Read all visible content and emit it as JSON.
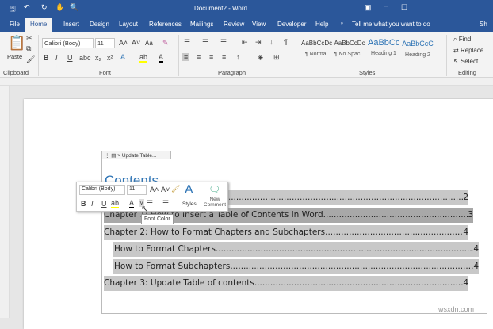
{
  "title": "Document2 - Word",
  "tabs": [
    "File",
    "Home",
    "Insert",
    "Design",
    "Layout",
    "References",
    "Mailings",
    "Review",
    "View",
    "Developer",
    "Help"
  ],
  "tell_me": "Tell me what you want to do",
  "share": "Sh",
  "clipboard": {
    "paste": "Paste",
    "label": "Clipboard"
  },
  "font": {
    "name": "Calibri (Body)",
    "size": "11",
    "label": "Font",
    "change_case": "Aa"
  },
  "paragraph": {
    "label": "Paragraph"
  },
  "styles": {
    "label": "Styles",
    "items": [
      {
        "preview": "AaBbCcDc",
        "name": "¶ Normal"
      },
      {
        "preview": "AaBbCcDc",
        "name": "¶ No Spac..."
      },
      {
        "preview": "AaBbCc",
        "name": "Heading 1"
      },
      {
        "preview": "AaBbCcC",
        "name": "Heading 2"
      }
    ]
  },
  "editing": {
    "label": "Editing",
    "find": "Find",
    "replace": "Replace",
    "select": "Select"
  },
  "toc": {
    "update_button": "Update Table...",
    "heading": "Contents",
    "entries": [
      {
        "text": "",
        "page": "2"
      },
      {
        "text": "Chapter 1: How to Insert a Table of Contents in Word.",
        "page": "3"
      },
      {
        "text": "Chapter 2: How to Format Chapters and Subchapters.",
        "page": "4"
      },
      {
        "text": "How to Format Chapters ",
        "page": "4"
      },
      {
        "text": "How to Format Subchapters",
        "page": "4"
      },
      {
        "text": "Chapter 3: Update Table of contents. ",
        "page": "4"
      }
    ]
  },
  "mini_toolbar": {
    "font": "Calibri (Body)",
    "size": "11",
    "styles": "Styles",
    "new_comment": "New Comment"
  },
  "tooltip": "Font Color",
  "watermark": "wsxdn.com"
}
